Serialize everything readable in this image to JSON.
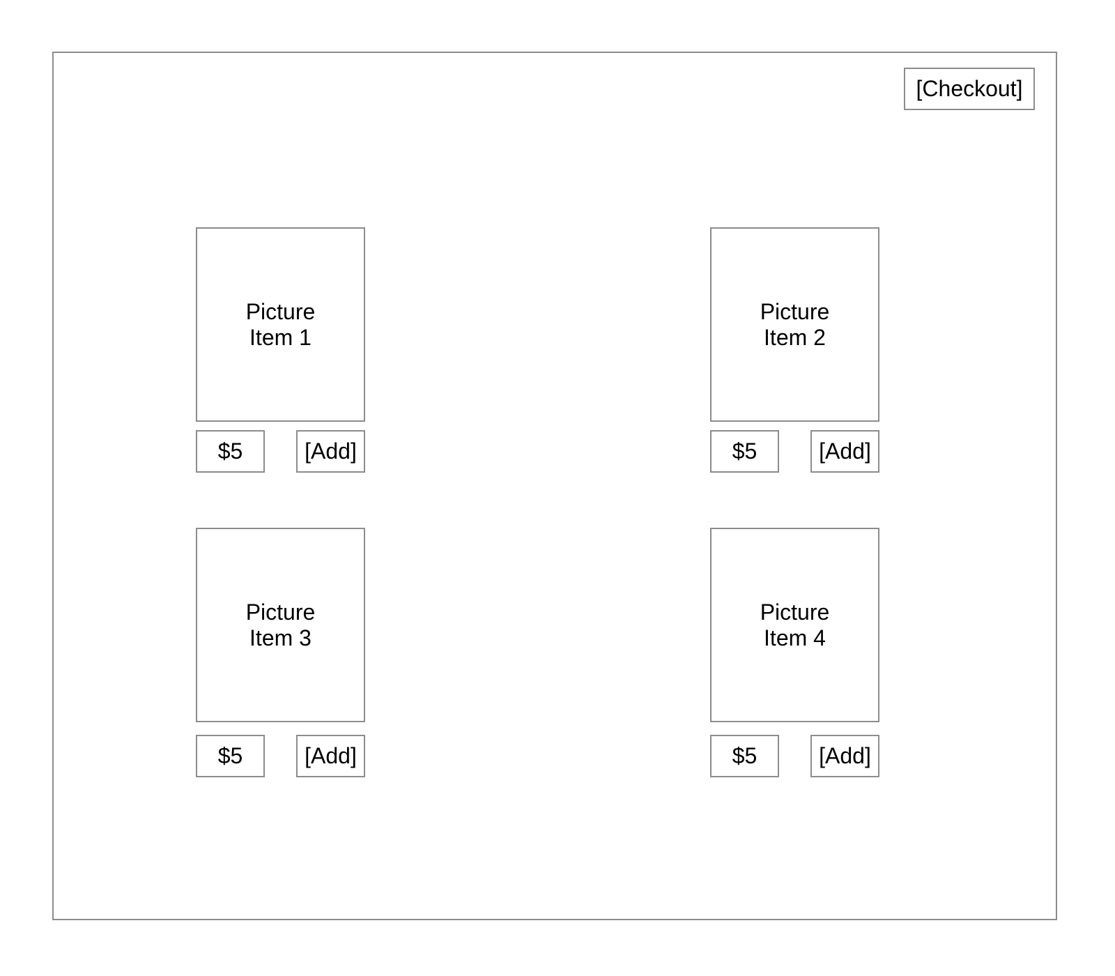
{
  "header": {
    "checkout_label": "[Checkout]"
  },
  "products": [
    {
      "picture_line1": "Picture",
      "picture_line2": "Item 1",
      "price": "$5",
      "add_label": "[Add]"
    },
    {
      "picture_line1": "Picture",
      "picture_line2": "Item 2",
      "price": "$5",
      "add_label": "[Add]"
    },
    {
      "picture_line1": "Picture",
      "picture_line2": "Item 3",
      "price": "$5",
      "add_label": "[Add]"
    },
    {
      "picture_line1": "Picture",
      "picture_line2": "Item 4",
      "price": "$5",
      "add_label": "[Add]"
    }
  ]
}
